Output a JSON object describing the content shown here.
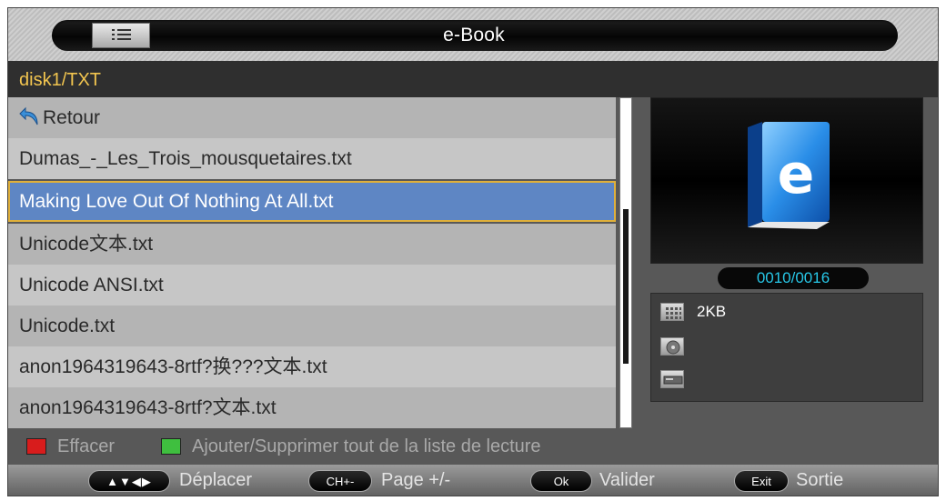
{
  "app": {
    "title": "e-Book"
  },
  "path": "disk1/TXT",
  "files": [
    {
      "label": "Retour",
      "icon": "back-arrow-icon"
    },
    {
      "label": "Dumas_-_Les_Trois_mousquetaires.txt"
    },
    {
      "label": "Making Love Out Of Nothing At All.txt",
      "selected": true
    },
    {
      "label": "Unicode文本.txt"
    },
    {
      "label": "Unicode ANSI.txt"
    },
    {
      "label": "Unicode.txt"
    },
    {
      "label": "anon1964319643-8rtf?换???文本.txt"
    },
    {
      "label": "anon1964319643-8rtf?文本.txt"
    }
  ],
  "preview": {
    "icon": "ebook-icon",
    "counter": "0010/0016"
  },
  "info": {
    "size": "2KB",
    "icons": [
      "grid-icon",
      "disc-icon",
      "device-icon"
    ]
  },
  "legend": {
    "red_label": "Effacer",
    "green_label": "Ajouter/Supprimer tout de la liste de lecture"
  },
  "footer": {
    "move_key": "▲▼◀▶",
    "move_label": "Déplacer",
    "page_key": "CH+-",
    "page_label": "Page +/-",
    "ok_key": "Ok",
    "ok_label": "Valider",
    "exit_key": "Exit",
    "exit_label": "Sortie"
  },
  "colors": {
    "accent": "#5e86c4",
    "selection_border": "#e0b03a",
    "path": "#f2c54f",
    "counter": "#27c8e8",
    "red_key": "#d81c1c",
    "green_key": "#3fbf3f"
  }
}
